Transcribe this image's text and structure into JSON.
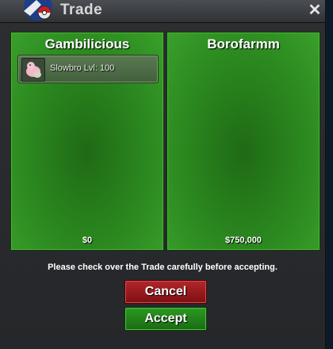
{
  "window": {
    "title": "Trade",
    "close_label": "✕"
  },
  "left_panel": {
    "player_name": "Gambilicious",
    "money": "$0",
    "items": [
      {
        "label": "Slowbro  Lvl: 100",
        "icon": "pokemon-icon"
      }
    ]
  },
  "right_panel": {
    "player_name": "Borofarmm",
    "money": "$750,000",
    "items": []
  },
  "footer": {
    "notice": "Please check over the Trade carefully before accepting.",
    "cancel_label": "Cancel",
    "accept_label": "Accept"
  },
  "colors": {
    "panel_green": "#2c8a20",
    "cancel_red": "#9a1a1e",
    "accept_green": "#23821b"
  }
}
